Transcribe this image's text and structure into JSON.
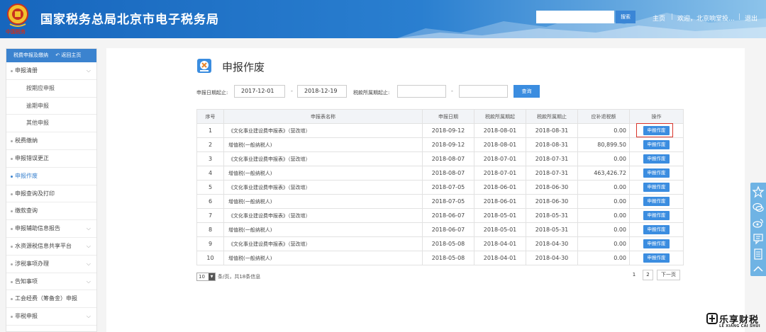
{
  "header": {
    "site_title": "国家税务总局北京市电子税务局",
    "motto": "中国税务",
    "search_placeholder": "",
    "search_button": "搜索",
    "home": "主页",
    "sep": "|",
    "welcome": "欢迎，北京响堂投...",
    "logout": "退出"
  },
  "sidebar": {
    "header": "税费申报及缴纳",
    "back": "返回主页",
    "items": [
      {
        "label": "申报清册",
        "level": 0,
        "has_chevron": true
      },
      {
        "label": "按期应申报",
        "level": 1
      },
      {
        "label": "逾期申报",
        "level": 1
      },
      {
        "label": "其他申报",
        "level": 1
      },
      {
        "label": "税费缴纳",
        "level": 0
      },
      {
        "label": "申报错误更正",
        "level": 0
      },
      {
        "label": "申报作废",
        "level": 0,
        "active": true
      },
      {
        "label": "申报查询及打印",
        "level": 0
      },
      {
        "label": "缴款查询",
        "level": 0
      },
      {
        "label": "申报辅助信息报告",
        "level": 0,
        "has_chevron": true
      },
      {
        "label": "水资源税信息共享平台",
        "level": 0,
        "has_chevron": true
      },
      {
        "label": "涉税事项办理",
        "level": 0,
        "has_chevron": true
      },
      {
        "label": "告知事项",
        "level": 0,
        "has_chevron": true
      },
      {
        "label": "工会经费（筹备金）申报",
        "level": 0
      },
      {
        "label": "非税申报",
        "level": 0,
        "has_chevron": true
      }
    ]
  },
  "main": {
    "page_title": "申报作废",
    "filters": {
      "declare_date_label": "申报日期起止:",
      "start_date": "2017-12-01",
      "dash": "-",
      "end_date": "2018-12-19",
      "period_label": "税款所属期起止:",
      "period_start": "",
      "period_end": "",
      "query_button": "查询"
    },
    "table": {
      "columns": [
        "序号",
        "申报表名称",
        "申报日期",
        "税款所属期起",
        "税款所属期止",
        "应补退税额",
        "操作"
      ],
      "action_label": "申报作废",
      "rows": [
        [
          "1",
          "《文化事业建设费申报表》（营改增）",
          "2018-09-12",
          "2018-08-01",
          "2018-08-31",
          "0.00"
        ],
        [
          "2",
          "增值税(一般纳税人)",
          "2018-09-12",
          "2018-08-01",
          "2018-08-31",
          "80,899.50"
        ],
        [
          "3",
          "《文化事业建设费申报表》（营改增）",
          "2018-08-07",
          "2018-07-01",
          "2018-07-31",
          "0.00"
        ],
        [
          "4",
          "增值税(一般纳税人)",
          "2018-08-07",
          "2018-07-01",
          "2018-07-31",
          "463,426.72"
        ],
        [
          "5",
          "《文化事业建设费申报表》（营改增）",
          "2018-07-05",
          "2018-06-01",
          "2018-06-30",
          "0.00"
        ],
        [
          "6",
          "增值税(一般纳税人)",
          "2018-07-05",
          "2018-06-01",
          "2018-06-30",
          "0.00"
        ],
        [
          "7",
          "《文化事业建设费申报表》（营改增）",
          "2018-06-07",
          "2018-05-01",
          "2018-05-31",
          "0.00"
        ],
        [
          "8",
          "增值税(一般纳税人)",
          "2018-06-07",
          "2018-05-01",
          "2018-05-31",
          "0.00"
        ],
        [
          "9",
          "《文化事业建设费申报表》（营改增）",
          "2018-05-08",
          "2018-04-01",
          "2018-04-30",
          "0.00"
        ],
        [
          "10",
          "增值税(一般纳税人)",
          "2018-05-08",
          "2018-04-01",
          "2018-04-30",
          "0.00"
        ]
      ]
    },
    "pagination": {
      "page_size": "10",
      "info": "条/页，共18条信息",
      "pages": [
        "1",
        "2"
      ],
      "next": "下一页"
    }
  },
  "floating_toolbar": {
    "icons": [
      "star-icon",
      "chat-icon",
      "weibo-icon",
      "comment-icon",
      "document-icon",
      "chevron-up-icon"
    ]
  },
  "watermark": {
    "cn": "乐享财税",
    "en": "LE XIANG CAI SHUI"
  },
  "colors": {
    "header_blue": "#1766bd",
    "accent_blue": "#3b8de0",
    "highlight_red": "#d9342b"
  }
}
